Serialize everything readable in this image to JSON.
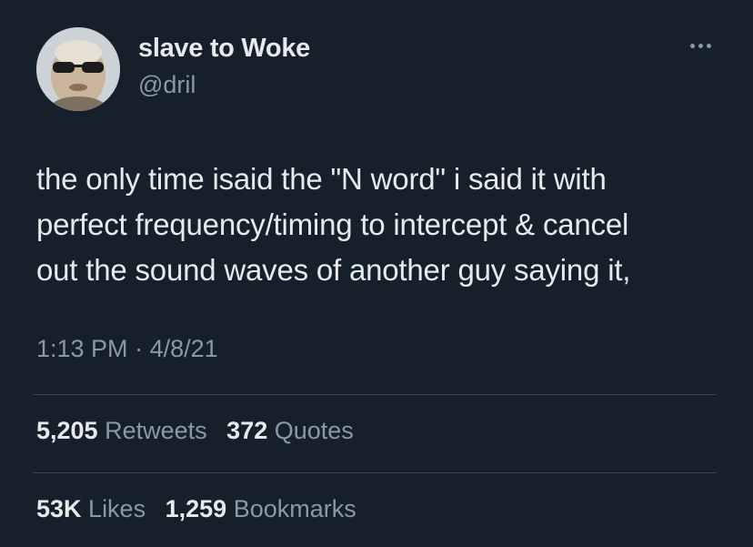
{
  "author": {
    "display_name": "slave to Woke",
    "handle": "@dril",
    "avatar_icon": "profile-photo"
  },
  "more_icon": "more-horizontal-icon",
  "tweet": {
    "lines": [
      "the only time isaid the \"N word\" i said it with",
      "perfect frequency/timing to intercept & cancel",
      "out the sound waves of another guy saying it,"
    ],
    "time": "1:13 PM",
    "separator": "·",
    "date": "4/8/21"
  },
  "stats": {
    "retweets": {
      "value": "5,205",
      "label": "Retweets"
    },
    "quotes": {
      "value": "372",
      "label": "Quotes"
    },
    "likes": {
      "value": "53K",
      "label": "Likes"
    },
    "bookmarks": {
      "value": "1,259",
      "label": "Bookmarks"
    }
  },
  "colors": {
    "background": "#15202b",
    "text_primary": "#e7e9ea",
    "text_secondary": "#8b98a5",
    "divider": "#38444d"
  }
}
